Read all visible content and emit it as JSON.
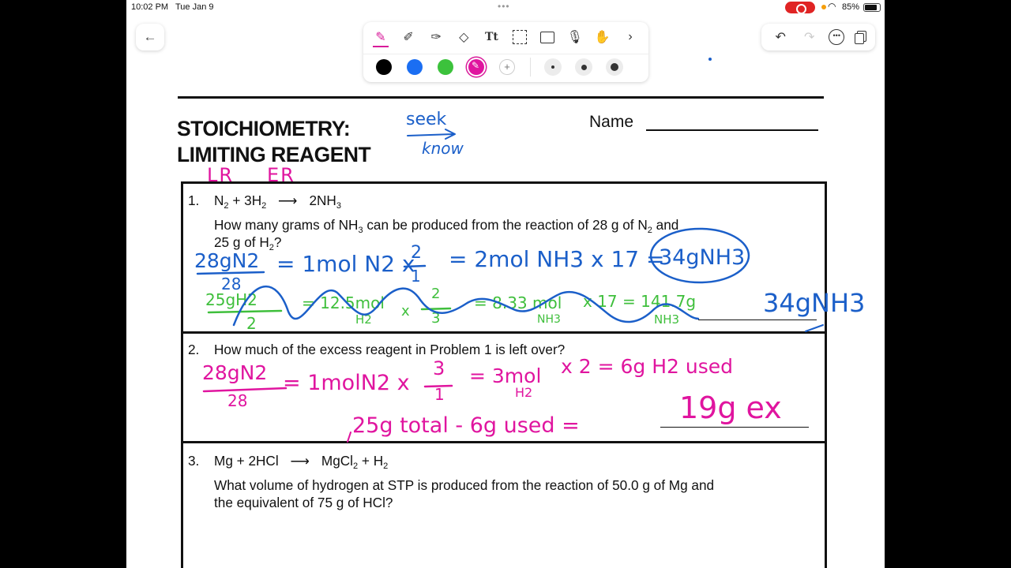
{
  "status_bar": {
    "time": "10:02 PM",
    "date": "Tue Jan 9",
    "battery": "85%"
  },
  "colors": {
    "black": "#000000",
    "blue": "#1b6ef2",
    "green": "#3cc23c",
    "magenta": "#e0159f",
    "selected_color": "magenta"
  },
  "toolbar": {
    "tools": [
      "pen-icon",
      "pencil-icon",
      "highlighter-icon",
      "eraser-icon",
      "text-icon",
      "lasso-icon",
      "image-icon",
      "microphone-icon",
      "hand-icon",
      "chevron-right-icon"
    ],
    "active_tool": "pen-icon"
  },
  "worksheet": {
    "title_line1": "STOICHIOMETRY:",
    "title_line2": "LIMITING REAGENT",
    "name_label": "Name"
  },
  "questions": {
    "q1_num": "1.",
    "q1_eq": [
      "N",
      "2",
      "+ 3H",
      "2",
      "2NH",
      "3"
    ],
    "q1_line1_a": "How many grams of NH",
    "q1_line1_sub": "3",
    "q1_line1_b": " can be produced from the reaction of 28 g of N",
    "q1_line1_sub2": "2",
    "q1_line1_c": " and",
    "q1_line2_a": "25 g of H",
    "q1_line2_sub": "2",
    "q1_line2_b": "?",
    "q2_num": "2.",
    "q2_text": "How much of the excess reagent in Problem 1 is left over?",
    "q3_num": "3.",
    "q3_eq": [
      "Mg + 2HCl",
      "MgCl",
      "2",
      "+ H",
      "2"
    ],
    "q3_line1": "What volume of hydrogen at STP is produced from the reaction of 50.0 g of Mg and",
    "q3_line2": "the equivalent of 75 g of HCl?"
  },
  "handwriting": {
    "seek": "seek",
    "know": "know",
    "lr": "LR",
    "er": "ER",
    "q1_blue": {
      "numerator": "28gN2",
      "denominator": "28",
      "step1": "= 1mol N2 x",
      "frac_num": "2",
      "frac_den": "1",
      "step2": "= 2mol NH3 x 17 =",
      "answer_circled": "34gNH3",
      "final": "34gNH3"
    },
    "q1_green": {
      "numerator": "25gH2",
      "denominator": "2",
      "step1": "= 12.5mol",
      "step1_sub": "H2",
      "x": "x",
      "frac_num": "2",
      "frac_den": "3",
      "step2": "= 8.33 mol",
      "step2_sub": "NH3",
      "step3": "x 17 = 141.7g",
      "step3_sub": "NH3"
    },
    "q2_magenta": {
      "numerator": "28gN2",
      "denominator": "28",
      "step1": "= 1molN2 x",
      "frac_num": "3",
      "frac_den": "1",
      "step2": "= 3mol",
      "step2_sub": "H2",
      "step3": "x 2 = 6g H2 used",
      "line2": "25g total - 6g used =",
      "answer": "19g ex"
    }
  }
}
